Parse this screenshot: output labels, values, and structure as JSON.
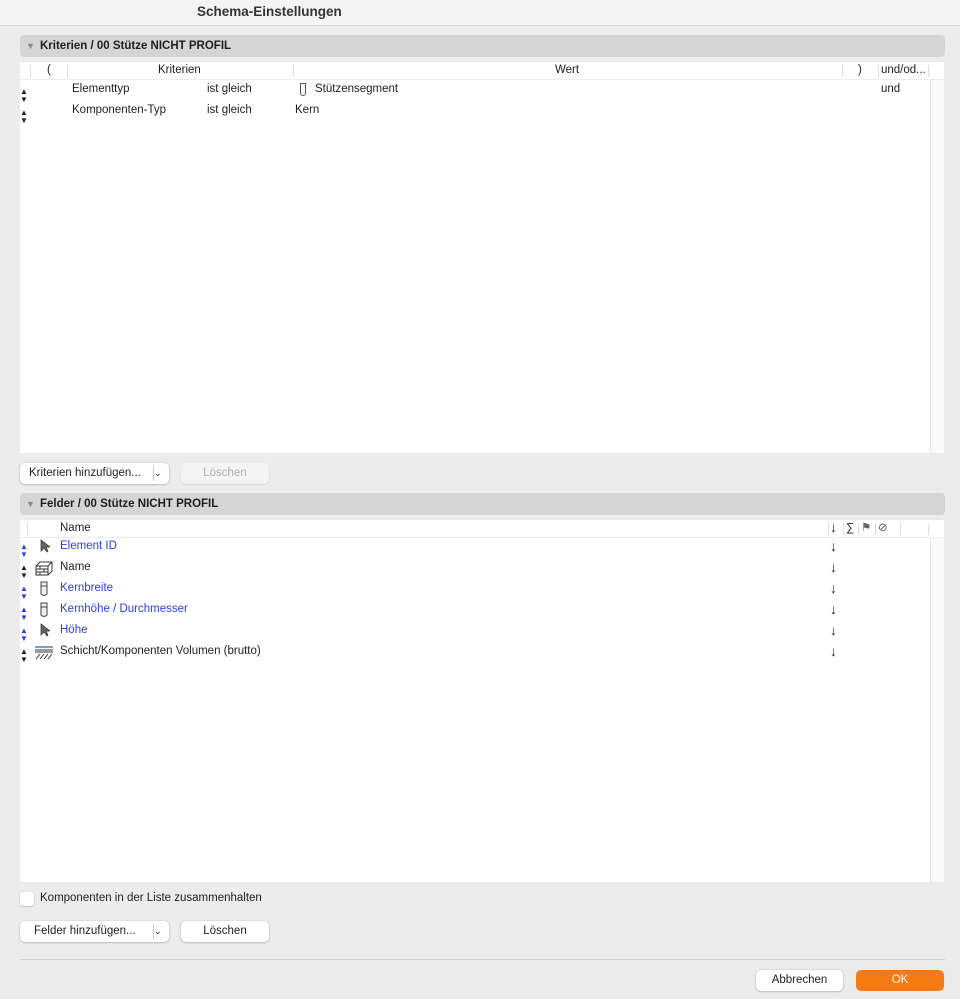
{
  "window": {
    "title": "Schema-Einstellungen"
  },
  "criteria": {
    "header": "Kriterien / 00 Stütze NICHT PROFIL",
    "columns": {
      "open_paren": "(",
      "criteria": "Kriterien",
      "value": "Wert",
      "close_paren": ")",
      "andor": "und/od..."
    },
    "rows": [
      {
        "criterion": "Elementtyp",
        "operator": "ist gleich",
        "value": "Stützensegment",
        "icon": "column-icon",
        "andor": "und"
      },
      {
        "criterion": "Komponenten-Typ",
        "operator": "ist gleich",
        "value": "Kern",
        "andor": ""
      }
    ],
    "add_button": "Kriterien hinzufügen...",
    "delete_button": "Löschen"
  },
  "fields": {
    "header": "Felder / 00 Stütze NICHT PROFIL",
    "columns": {
      "name": "Name",
      "sort": "↓",
      "sum": "∑"
    },
    "rows": [
      {
        "name": "Element ID",
        "icon": "pointer-icon",
        "blue": true,
        "sort": "↓"
      },
      {
        "name": "Name",
        "icon": "wall-icon",
        "blue": false,
        "sort": "↓"
      },
      {
        "name": "Kernbreite",
        "icon": "column-icon",
        "blue": true,
        "sort": "↓"
      },
      {
        "name": "Kernhöhe / Durchmesser",
        "icon": "column-icon",
        "blue": true,
        "sort": "↓"
      },
      {
        "name": "Höhe",
        "icon": "pointer-icon",
        "blue": true,
        "sort": "↓"
      },
      {
        "name": "Schicht/Komponenten Volumen (brutto)",
        "icon": "layers-icon",
        "blue": false,
        "sort": "↓"
      }
    ],
    "keep_components_label": "Komponenten in der Liste zusammenhalten",
    "keep_components_checked": false,
    "add_button": "Felder hinzufügen...",
    "delete_button": "Löschen"
  },
  "footer": {
    "cancel": "Abbrechen",
    "ok": "OK"
  },
  "colors": {
    "accent": "#f57a14",
    "link": "#2b3fd6"
  }
}
